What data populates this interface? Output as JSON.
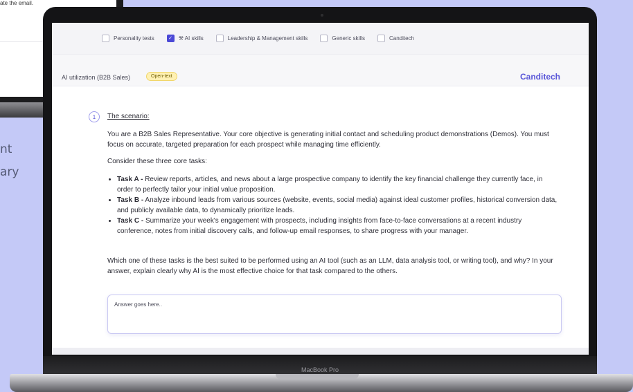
{
  "background": {
    "snippet_text": "ate the email.",
    "side_text": [
      "nt",
      "ary"
    ]
  },
  "device": {
    "label": "MacBook Pro"
  },
  "toolbar": {
    "filters": [
      {
        "label": "Personality tests",
        "checked": false
      },
      {
        "label": "⚒ AI skills",
        "checked": true
      },
      {
        "label": "Leadership & Management skills",
        "checked": false
      },
      {
        "label": "Generic skills",
        "checked": false
      },
      {
        "label": "Canditech",
        "checked": false
      }
    ]
  },
  "header": {
    "title": "AI utilization (B2B Sales)",
    "badge": "Open-text",
    "brand": "Canditech"
  },
  "question": {
    "number": "1",
    "title": "The scenario:",
    "intro": "You are a B2B Sales Representative. Your core objective is generating initial contact and scheduling product demonstrations (Demos). You must focus on accurate, targeted preparation for each prospect while managing time efficiently.",
    "consider": "Consider these three core tasks:",
    "tasks": [
      {
        "label": "Task A -",
        "text": " Review reports, articles, and news about a large prospective company to identify the key financial challenge they currently face, in order to perfectly tailor your initial value proposition."
      },
      {
        "label": "Task B -",
        "text": " Analyze inbound leads from various sources (website, events, social media) against ideal customer profiles, historical conversion data, and publicly available data, to dynamically prioritize leads."
      },
      {
        "label": "Task C -",
        "text": " Summarize your week's engagement with prospects, including insights from face-to-face conversations at a recent industry conference, notes from initial discovery calls, and follow-up email responses, to share progress with your manager."
      }
    ],
    "prompt": "Which one of these tasks is the best suited to be performed using an AI tool (such as an LLM, data analysis tool, or writing tool), and why? In your answer, explain clearly why AI is the most effective choice for that task compared to the others."
  },
  "answer": {
    "placeholder": "Answer goes here.."
  },
  "colors": {
    "accent": "#5855d8",
    "background": "#c4c9f7",
    "badge": "#fff1b3"
  }
}
